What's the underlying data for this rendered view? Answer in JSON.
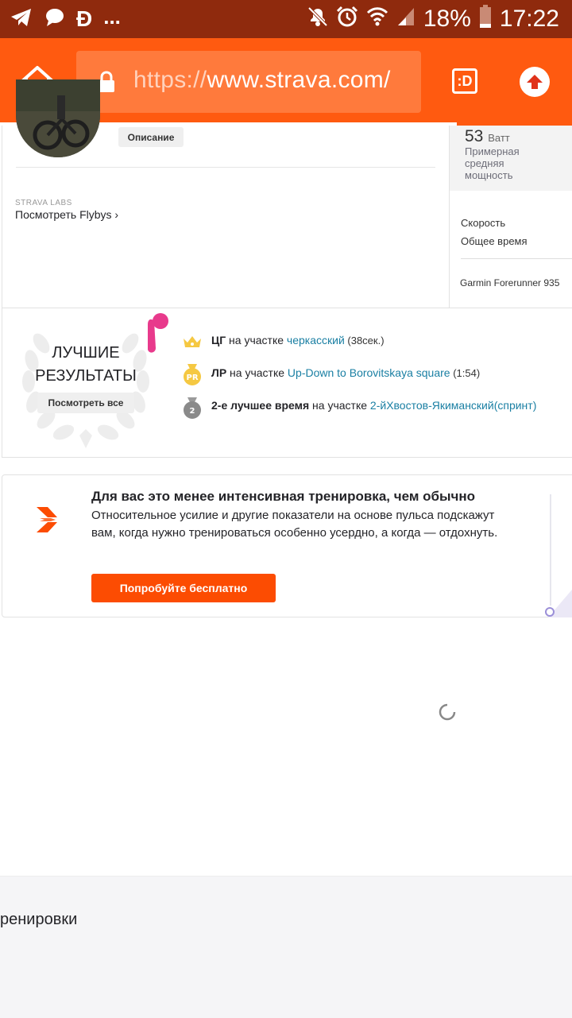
{
  "status_bar": {
    "battery": "18%",
    "time": "17:22",
    "dots": "...",
    "d_icon": "Đ",
    "icons_left": [
      "telegram-icon",
      "chat-bubble-icon",
      "d-coin-icon"
    ],
    "icons_right": [
      "mute-icon",
      "alarm-icon",
      "wifi-icon",
      "signal-icon",
      "battery-icon"
    ]
  },
  "browser": {
    "url_prefix": "https://",
    "url_host": "www.strava.com/",
    "tabs_label": ":D",
    "accent": "#ff5a10"
  },
  "activity": {
    "description_button": "Описание",
    "labs_label": "STRAVA LABS",
    "flybys_link": "Посмотреть Flybys ›",
    "watts_value": "53",
    "watts_unit": "Ватт",
    "watts_caption": "Примерная средняя мощность",
    "speed_label": "Скорость",
    "elapsed_label": "Общее время",
    "device": "Garmin Forerunner 935"
  },
  "achievements": {
    "title": "ЛУЧШИЕ РЕЗУЛЬТАТЫ",
    "see_all": "Посмотреть все",
    "rows": [
      {
        "bold": "ЦГ",
        "middle": " на участке ",
        "link": "черкасский",
        "extra": " (38сек.)",
        "icon": "crown-icon"
      },
      {
        "bold": "ЛР",
        "middle": " на участке ",
        "link": "Up-Down to Borovitskaya square",
        "extra": " (1:54)",
        "icon": "pr-medal-icon"
      },
      {
        "bold": "2-е лучшее время",
        "middle": " на участке ",
        "link": "2-йХвостов-Якиманский(спринт)",
        "extra": "",
        "icon": "silver-medal-icon"
      }
    ]
  },
  "promo": {
    "title": "Для вас это менее интенсивная тренировка, чем обычно",
    "text": "Относительное усилие и другие показатели на основе пульса подскажут вам, когда нужно тренироваться особенно усердно, а когда — отдохнуть.",
    "button": "Попробуйте бесплатно"
  },
  "bottom": {
    "text": "ренировки"
  }
}
